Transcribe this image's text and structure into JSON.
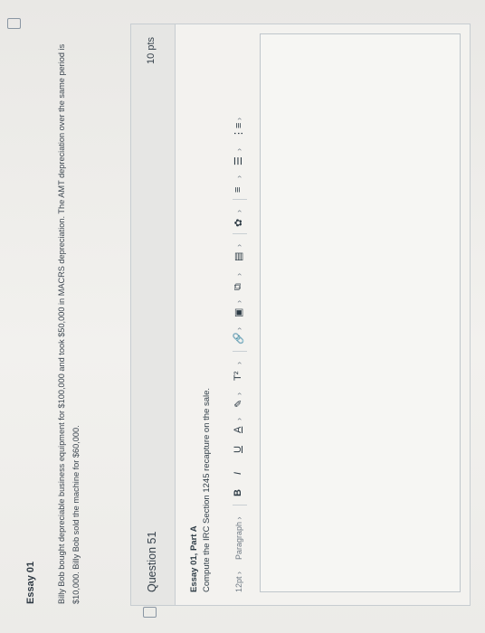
{
  "essay": {
    "title": "Essay 01",
    "body": "Billy Bob bought depreciable business equipment for $100,000 and took $50,000 in MACRS depreciation. The AMT depreciation over the same period is $10,000. Billy Bob sold the machine for $60,000."
  },
  "question": {
    "title": "Question 51",
    "points": "10 pts",
    "heading": "Essay 01, Part A",
    "prompt": "Compute the IRC Section 1245 recapture on the sale."
  },
  "toolbar": {
    "font_size": "12pt",
    "paragraph": "Paragraph",
    "bold": "B",
    "italic": "I",
    "underline": "U",
    "text_color": "A",
    "highlight": "✎",
    "superscript": "T²",
    "link": "🔗",
    "image": "▣",
    "media": "⧉",
    "document": "▤",
    "embed": "✿",
    "align": "≡",
    "list": "☰",
    "more": "⋮≡",
    "chevron": "›"
  }
}
